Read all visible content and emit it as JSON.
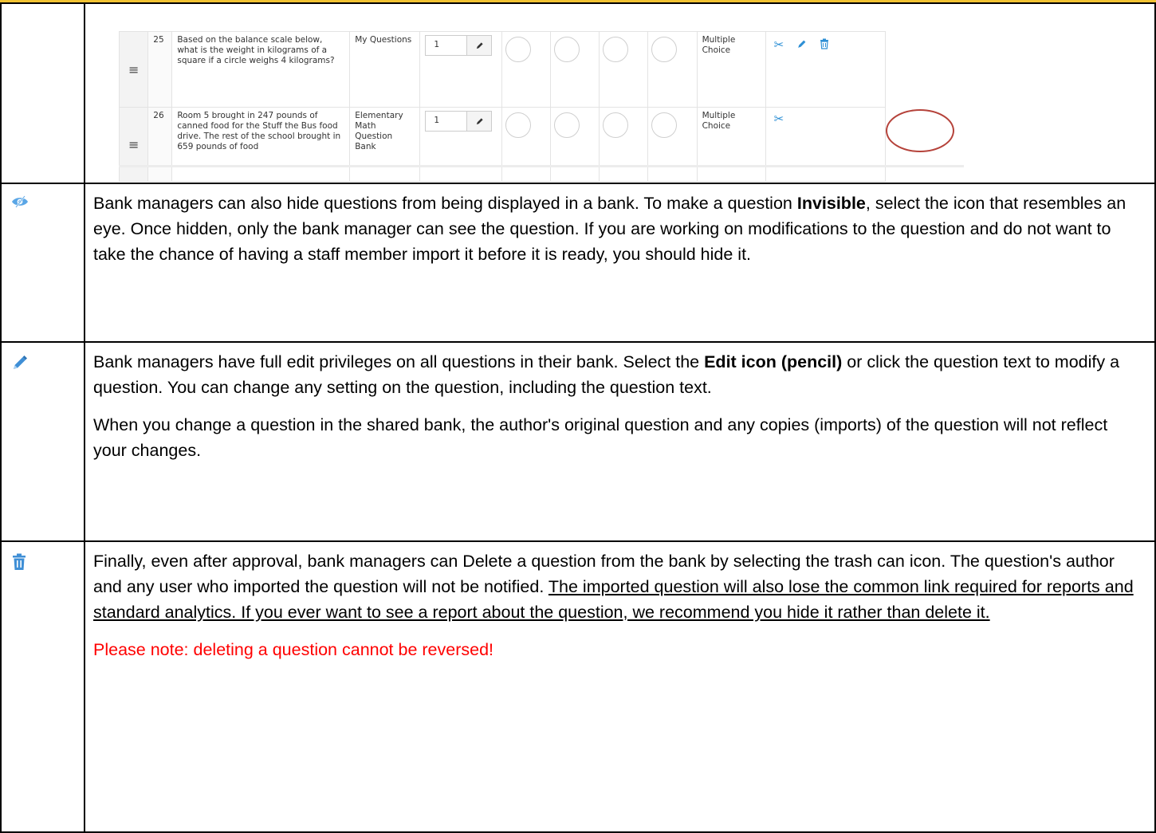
{
  "screenshot": {
    "rows": [
      {
        "number": "25",
        "question": "Based on the balance scale below, what is the weight in kilograms of a square if a circle weighs 4 kilograms?",
        "bank": "My Questions",
        "points": "1",
        "type": "Multiple Choice",
        "actions": [
          "scissors-icon",
          "pencil-icon",
          "trash-icon"
        ]
      },
      {
        "number": "26",
        "question": "Room 5 brought in 247 pounds of canned food for the Stuff the Bus food drive. The rest of the school brought in 659 pounds of food",
        "bank": "Elementary Math Question Bank",
        "points": "1",
        "type": "Multiple Choice",
        "actions": [
          "scissors-icon"
        ]
      }
    ],
    "accent_color": "#2d8fd5",
    "highlight_color": "#b5423a"
  },
  "sections": {
    "invisible": {
      "icon": "eye-hidden-icon",
      "text_a": "Bank managers can also hide questions from being displayed in a bank. To make a question ",
      "bold": "Invisible",
      "text_b": ", select the icon that resembles an eye. Once hidden, only the bank manager can see the question. If you are working on modifications to the question and do not want to take the chance of having a staff member import it before it is ready, you should hide it."
    },
    "edit": {
      "icon": "pencil-icon",
      "p1_a": "Bank managers have full edit privileges on all questions in their bank. Select the ",
      "p1_bold": "Edit icon (pencil)",
      "p1_b": " or click the question text to modify a question. You can change any setting on the question, including the question text.",
      "p2": "When you change a question in the shared bank, the author's original question and any copies (imports) of the question will not reflect your changes."
    },
    "delete": {
      "icon": "trash-icon",
      "p1": "Finally, even after approval, bank managers can Delete a question from the bank by selecting the trash can icon. The question's author and any user who imported the question will not be notified. ",
      "p1_underlined": "The imported question will also lose the common link required for reports and standard analytics. If you ever want to see a report about the question, we recommend you hide it rather than delete it.",
      "warning": "Please note: deleting a question cannot be reversed!",
      "warning_color": "#ff0000"
    }
  },
  "top_bar_color": "#f1c232"
}
